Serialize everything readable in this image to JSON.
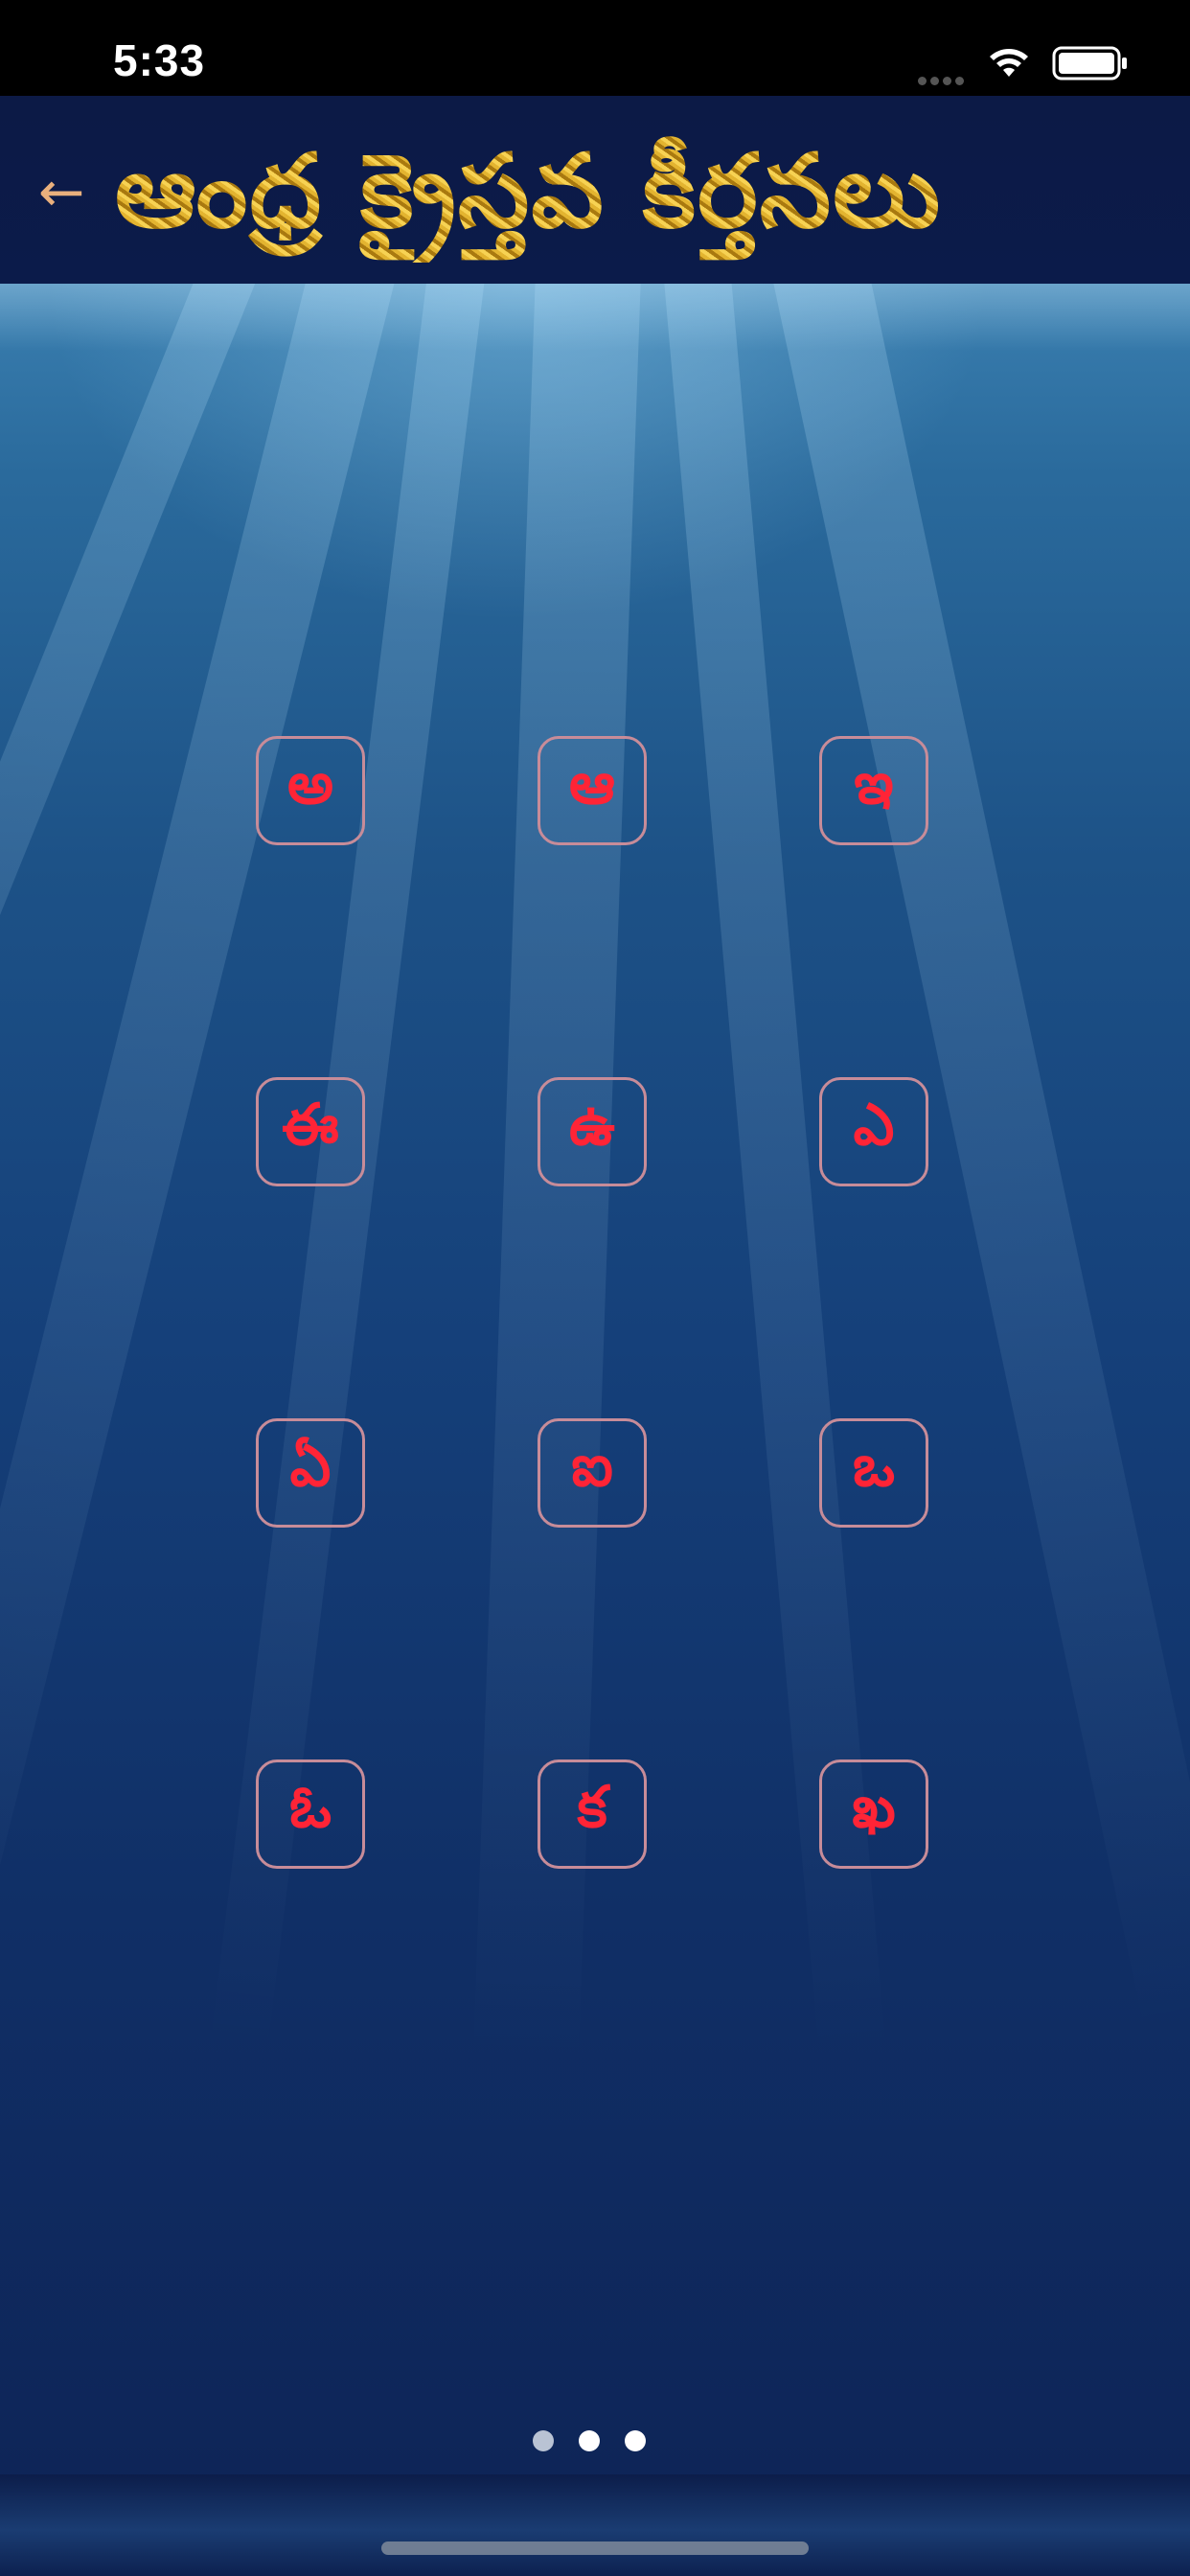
{
  "status_bar": {
    "time": "5:33"
  },
  "header": {
    "back_label": "←",
    "title": "ఆంధ్ర క్రైస్తవ కీర్తనలు"
  },
  "letters": [
    "అ",
    "ఆ",
    "ఇ",
    "ఈ",
    "ఉ",
    "ఎ",
    "ఏ",
    "ఐ",
    "ఒ",
    "ఓ",
    "క",
    "ఖ"
  ],
  "pager": {
    "total_pages": 3,
    "active_page": 2
  },
  "colors": {
    "letter": "#ff2436",
    "tile_border": "#c78c99",
    "title_gold": "#d7a71c",
    "back_arrow": "#e9b07d"
  }
}
